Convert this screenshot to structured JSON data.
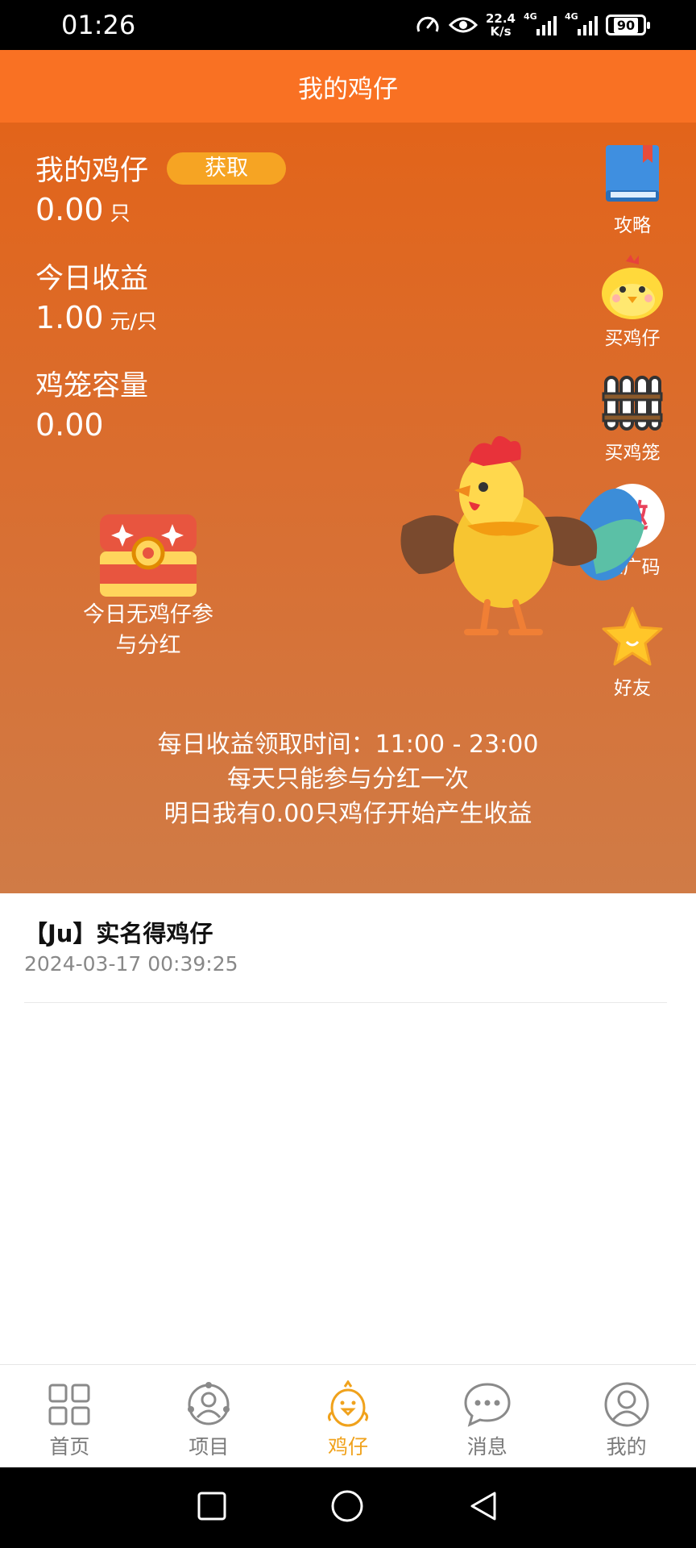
{
  "status_bar": {
    "time": "01:26",
    "net_speed_value": "22.4",
    "net_speed_unit": "K/s",
    "signal_label": "4G",
    "battery": "90",
    "icons": [
      "speedometer-icon",
      "eye-icon",
      "signal-icon",
      "battery-icon"
    ]
  },
  "header": {
    "title": "我的鸡仔"
  },
  "stats": {
    "my_chicks": {
      "label": "我的鸡仔",
      "value": "0.00",
      "unit": "只",
      "button": "获取"
    },
    "today_income": {
      "label": "今日收益",
      "value": "1.00",
      "unit": "元/只"
    },
    "cage_capacity": {
      "label": "鸡笼容量",
      "value": "0.00"
    }
  },
  "side_menu": [
    {
      "label": "攻略",
      "icon": "book-icon"
    },
    {
      "label": "买鸡仔",
      "icon": "chick-icon"
    },
    {
      "label": "买鸡笼",
      "icon": "fence-icon"
    },
    {
      "label": "推广码",
      "icon": "invite-icon",
      "icon_text": "邀"
    },
    {
      "label": "好友",
      "icon": "star-icon"
    }
  ],
  "chest": {
    "label_line1": "今日无鸡仔参",
    "label_line2": "与分红",
    "icon": "treasure-chest-icon"
  },
  "info": {
    "line1": "每日收益领取时间：11:00 - 23:00",
    "line2": "每天只能参与分红一次",
    "line3": "明日我有0.00只鸡仔开始产生收益"
  },
  "records": [
    {
      "title": "【Ju】实名得鸡仔",
      "time": "2024-03-17 00:39:25"
    }
  ],
  "bottom_nav": [
    {
      "label": "首页",
      "icon": "grid-icon",
      "active": false
    },
    {
      "label": "项目",
      "icon": "project-icon",
      "active": false
    },
    {
      "label": "鸡仔",
      "icon": "chick-icon",
      "active": true
    },
    {
      "label": "消息",
      "icon": "chat-icon",
      "active": false
    },
    {
      "label": "我的",
      "icon": "user-icon",
      "active": false
    }
  ],
  "colors": {
    "header": "#f97123",
    "accent": "#f6a423",
    "active_nav": "#f0a21c"
  }
}
